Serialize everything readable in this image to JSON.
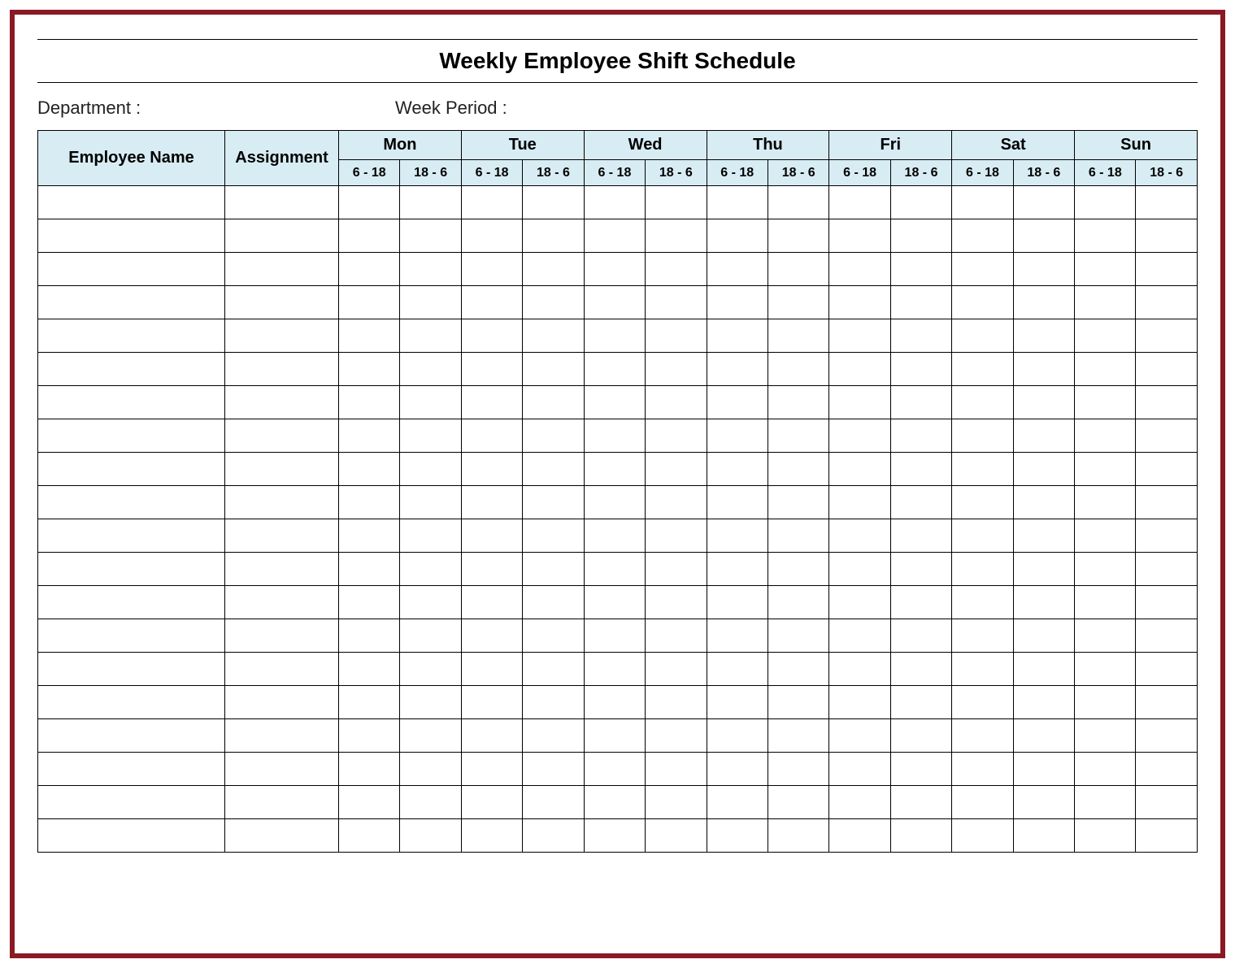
{
  "title": "Weekly Employee Shift Schedule",
  "meta": {
    "department_label": "Department :",
    "week_period_label": "Week  Period :"
  },
  "headers": {
    "employee_name": "Employee Name",
    "assignment": "Assignment",
    "days": [
      "Mon",
      "Tue",
      "Wed",
      "Thu",
      "Fri",
      "Sat",
      "Sun"
    ],
    "shifts": [
      "6 - 18",
      "18 - 6"
    ]
  },
  "row_count": 20,
  "colors": {
    "frame_border": "#8a1924",
    "header_bg": "#d8ecf4"
  }
}
